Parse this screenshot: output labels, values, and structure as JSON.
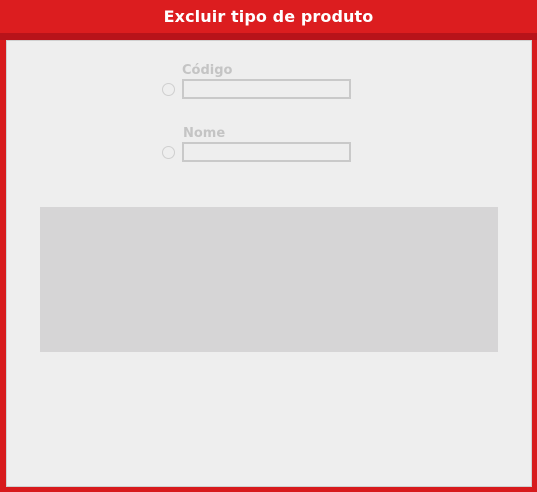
{
  "window": {
    "title": "Excluir tipo de produto"
  },
  "form": {
    "codigo": {
      "label": "Código",
      "value": ""
    },
    "nome": {
      "label": "Nome",
      "value": ""
    }
  },
  "colors": {
    "title_bar": "#dc1d1f",
    "panel": "#eeeeee",
    "results_area": "#d6d5d6"
  }
}
